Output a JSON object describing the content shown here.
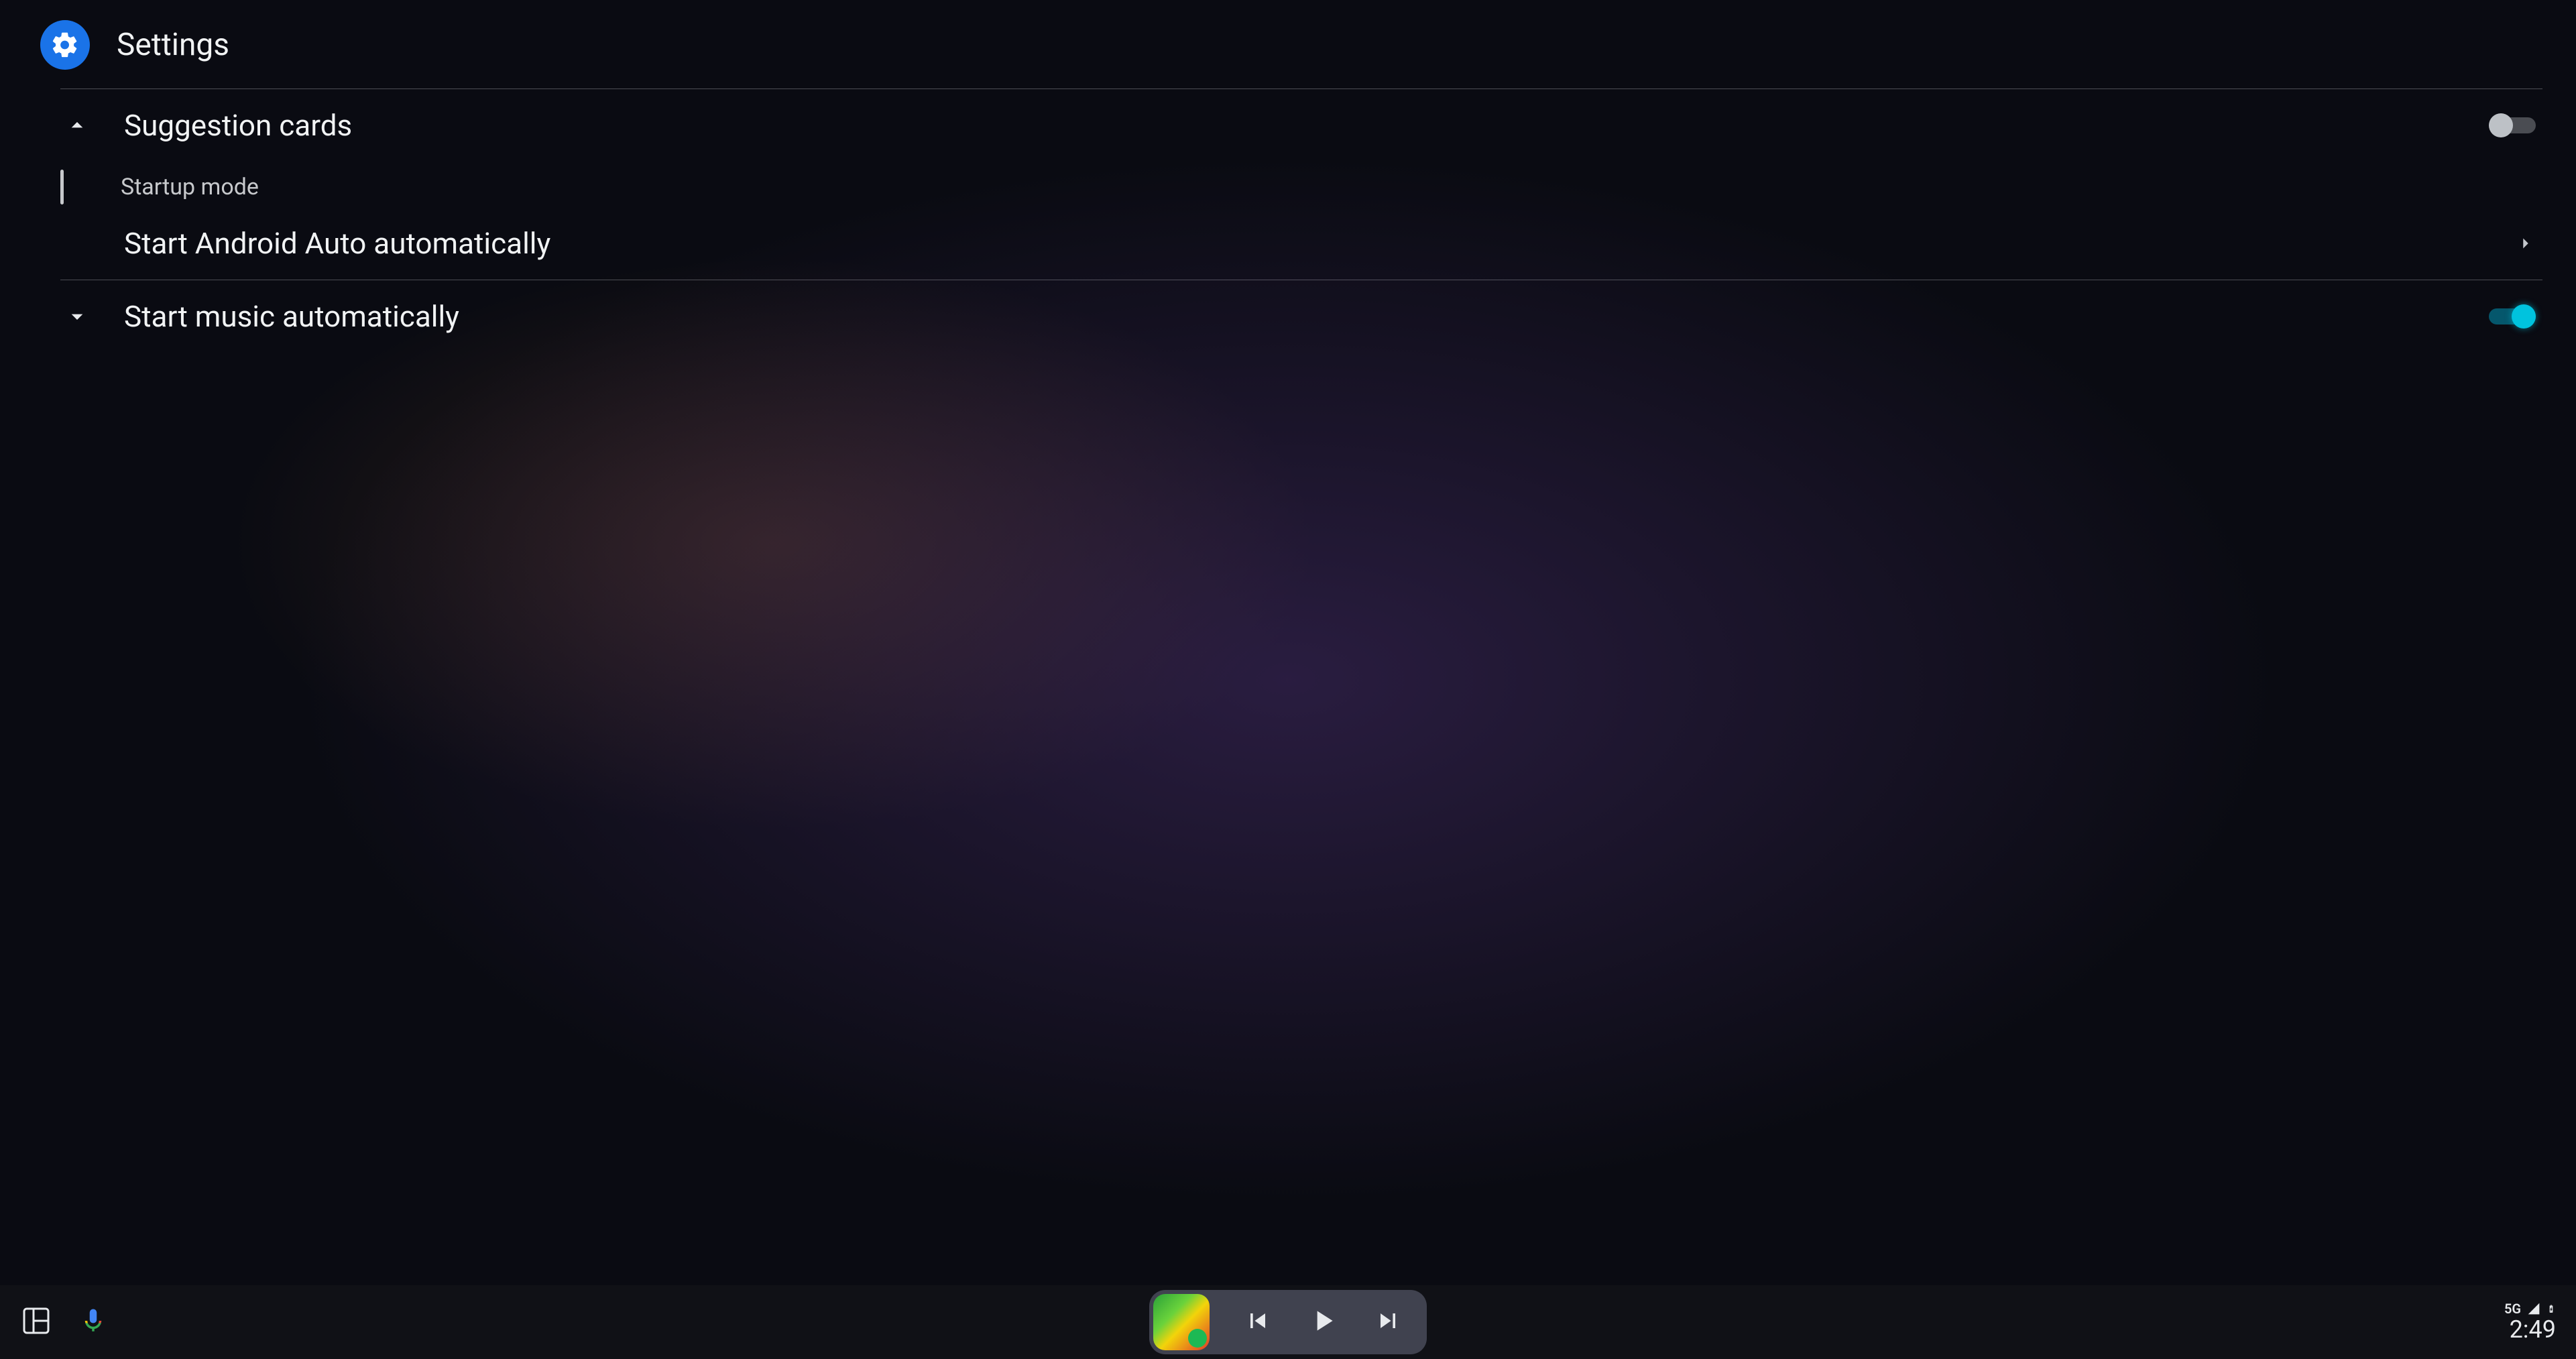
{
  "header": {
    "title": "Settings"
  },
  "rows": {
    "suggestion_cards": {
      "label": "Suggestion cards",
      "enabled": false
    },
    "startup_mode": {
      "label": "Startup mode"
    },
    "start_auto": {
      "label": "Start Android Auto automatically"
    },
    "start_music": {
      "label": "Start music automatically",
      "enabled": true
    }
  },
  "status": {
    "network": "5G",
    "clock": "2:49"
  }
}
